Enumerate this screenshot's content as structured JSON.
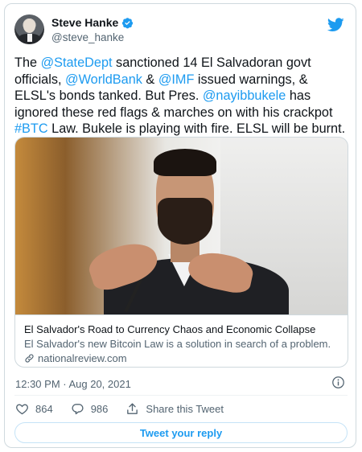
{
  "tweet": {
    "author": {
      "name": "Steve Hanke",
      "handle": "@steve_hanke",
      "verified": true
    },
    "text_segments": [
      {
        "text": "The ",
        "link": false
      },
      {
        "text": "@StateDept",
        "link": true
      },
      {
        "text": " sanctioned 14 El Salvadoran govt officials, ",
        "link": false
      },
      {
        "text": "@WorldBank",
        "link": true
      },
      {
        "text": " & ",
        "link": false
      },
      {
        "text": "@IMF",
        "link": true
      },
      {
        "text": " issued warnings, & ELSL's bonds tanked. But Pres. ",
        "link": false
      },
      {
        "text": "@nayibbukele",
        "link": true
      },
      {
        "text": " has ignored these red flags & marches on with his crackpot ",
        "link": false
      },
      {
        "text": "#BTC",
        "link": true
      },
      {
        "text": " Law. Bukele is playing with fire. ELSL will be burnt.",
        "link": false
      }
    ],
    "card": {
      "title": "El Salvador's Road to Currency Chaos and Economic Collapse",
      "description": "El Salvador's new Bitcoin Law is a solution in search of a problem.",
      "domain": "nationalreview.com"
    },
    "timestamp": "12:30 PM · Aug 20, 2021",
    "likes": "864",
    "replies": "986",
    "share_label": "Share this Tweet",
    "reply_button_label": "Tweet your reply"
  },
  "colors": {
    "accent": "#1d9bf0",
    "text": "#0f1419",
    "secondary": "#536471",
    "border": "#cfd9de"
  },
  "icons": {
    "verified": "verified-badge-icon",
    "brand": "twitter-bird-icon",
    "link": "link-icon",
    "info": "info-icon",
    "like": "heart-icon",
    "reply": "comment-icon",
    "share": "share-icon"
  }
}
